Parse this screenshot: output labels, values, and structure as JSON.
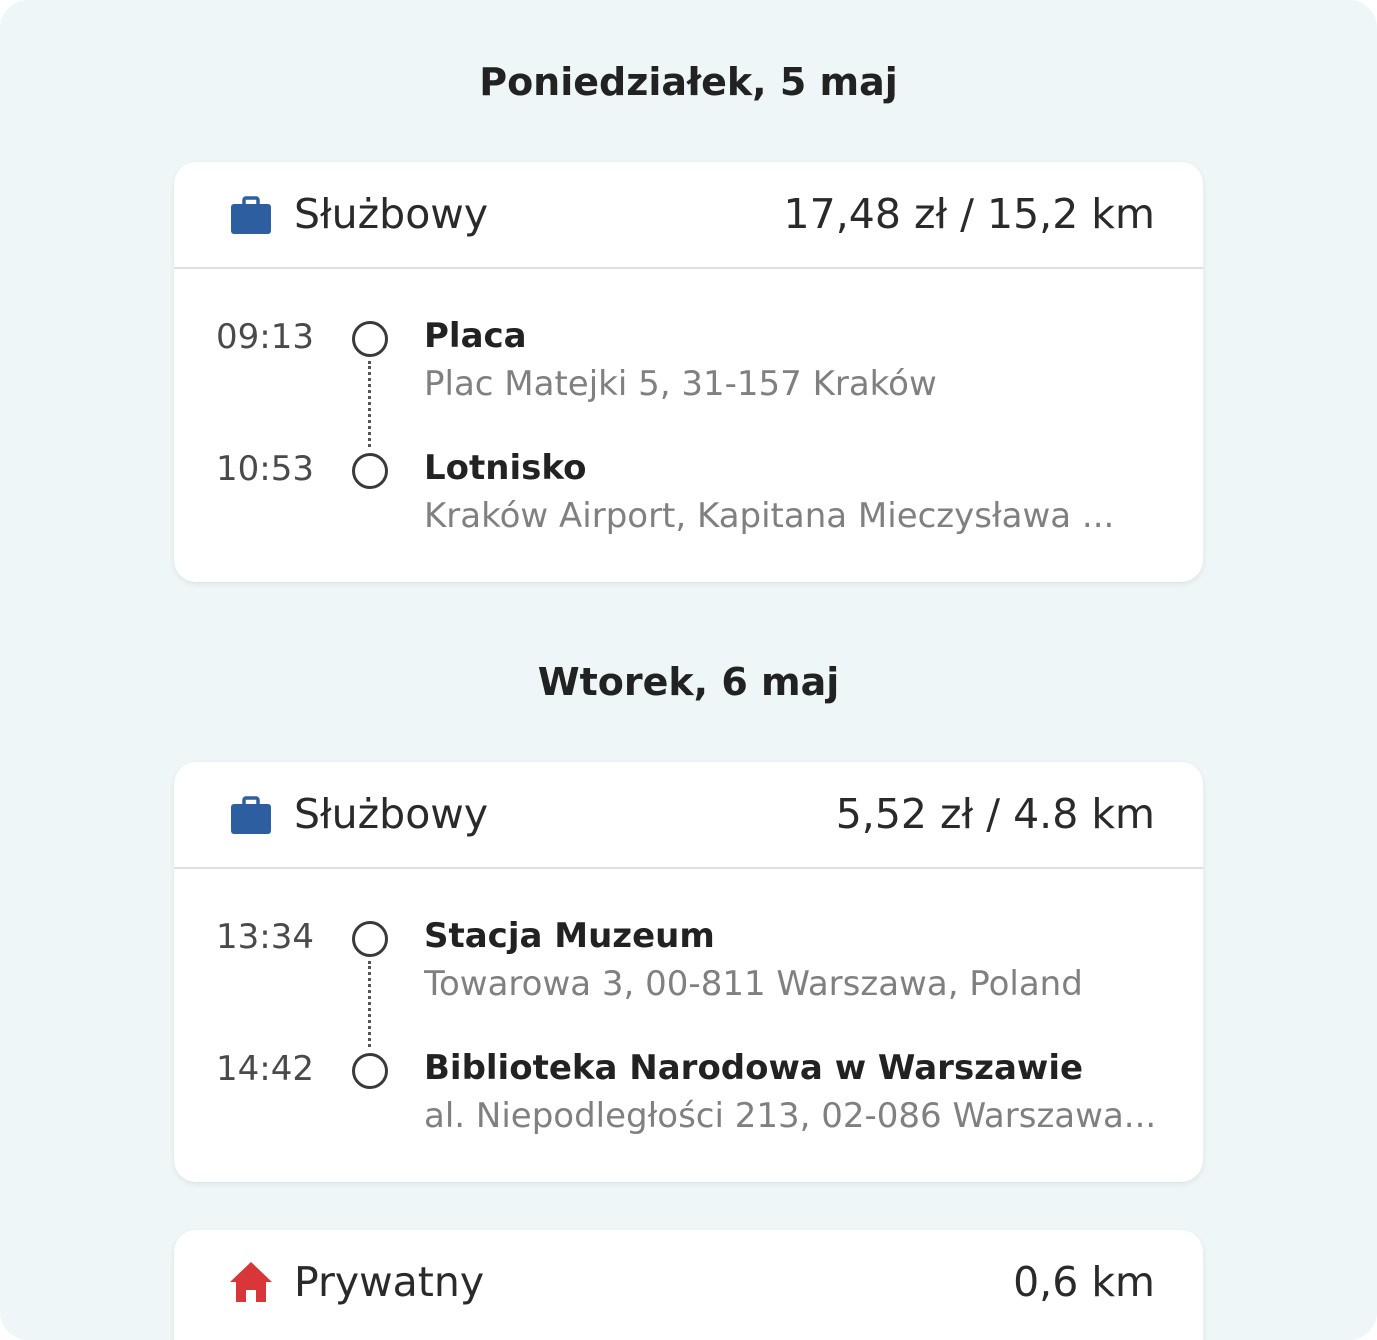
{
  "days": [
    {
      "heading": "Poniedziałek, 5 maj",
      "trip": {
        "category": "Służbowy",
        "category_icon": "briefcase-icon",
        "amount": "17,48 zł / 15,2 km",
        "stops": [
          {
            "time": "09:13",
            "name": "Placa",
            "address": "Plac Matejki 5, 31-157 Kraków"
          },
          {
            "time": "10:53",
            "name": "Lotnisko",
            "address": "Kraków Airport, Kapitana Mieczysława ..."
          }
        ]
      }
    },
    {
      "heading": "Wtorek, 6 maj",
      "trip": {
        "category": "Służbowy",
        "category_icon": "briefcase-icon",
        "amount": "5,52 zł / 4.8 km",
        "stops": [
          {
            "time": "13:34",
            "name": "Stacja Muzeum",
            "address": "Towarowa 3, 00-811 Warszawa, Poland"
          },
          {
            "time": "14:42",
            "name": "Biblioteka Narodowa w Warszawie",
            "address": "al. Niepodległości 213, 02-086 Warszawa..."
          }
        ]
      },
      "trip2": {
        "category": "Prywatny",
        "category_icon": "home-icon",
        "amount": "0,6 km"
      }
    }
  ],
  "colors": {
    "background": "#eef6f7",
    "business_icon": "#2d5fa0",
    "private_icon": "#d9363a"
  }
}
